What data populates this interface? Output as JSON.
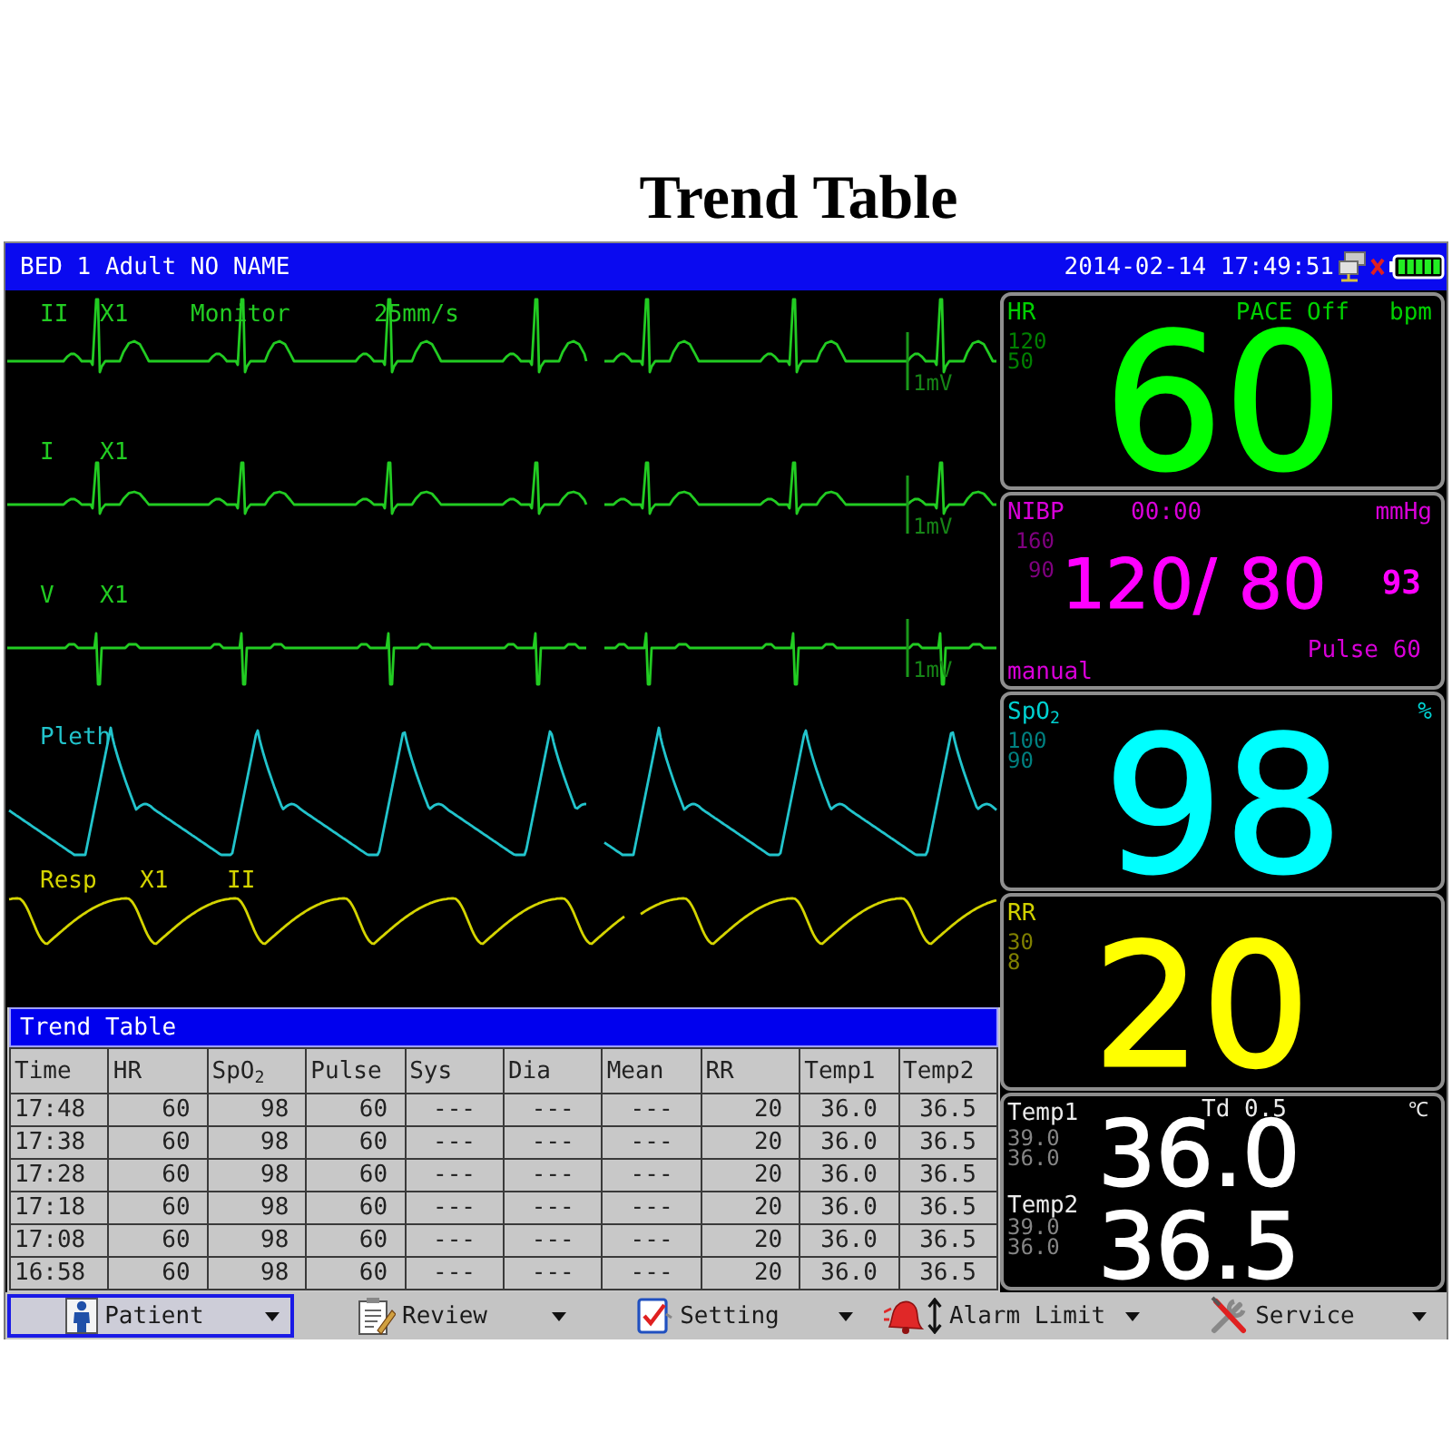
{
  "title": "Trend Table",
  "header": {
    "patient": "BED 1 Adult NO NAME",
    "datetime": "2014-02-14 17:49:51"
  },
  "waveforms": [
    {
      "kind": "ecg",
      "labels": [
        "II",
        "X1",
        "Monitor",
        "25mm/s"
      ],
      "scale": "1mV",
      "color": "#22cc22"
    },
    {
      "kind": "ecg",
      "labels": [
        "I",
        "X1"
      ],
      "scale": "1mV",
      "color": "#22cc22"
    },
    {
      "kind": "ecg",
      "labels": [
        "V",
        "X1"
      ],
      "scale": "1mV",
      "color": "#22cc22"
    },
    {
      "kind": "pleth",
      "labels": [
        "Pleth"
      ],
      "color": "#22c4cc"
    },
    {
      "kind": "resp",
      "labels": [
        "Resp",
        "X1",
        "II"
      ],
      "color": "#d4d400"
    }
  ],
  "parameters": [
    {
      "kind": "hr",
      "label": "HR",
      "limits": [
        "120",
        "50"
      ],
      "status": "PACE Off",
      "unit": "bpm",
      "value": "60",
      "color": "#00ff00"
    },
    {
      "kind": "nibp",
      "label": "NIBP",
      "time": "00:00",
      "unit": "mmHg",
      "limits": [
        "160",
        "90"
      ],
      "value": "120/ 80",
      "mean": "93",
      "pulse": "Pulse 60",
      "mode": "manual",
      "color": "#ff00ff"
    },
    {
      "kind": "spo2",
      "label": "SpO$_{2}$",
      "limits": [
        "100",
        "90"
      ],
      "unit": "%",
      "value": "98",
      "color": "#00ffff"
    },
    {
      "kind": "rr",
      "label": "RR",
      "limits": [
        "30",
        "8"
      ],
      "value": "20",
      "color": "#ffff00"
    },
    {
      "kind": "temp",
      "delta": "Td 0.5",
      "unit": "℃",
      "channels": [
        {
          "label": "Temp1",
          "limits": [
            "39.0",
            "36.0"
          ],
          "value": "36.0"
        },
        {
          "label": "Temp2",
          "limits": [
            "39.0",
            "36.0"
          ],
          "value": "36.5"
        }
      ],
      "color": "#ffffff"
    }
  ],
  "trend_table": {
    "title": "Trend Table",
    "columns": [
      "Time",
      "HR",
      "SpO$_{2}$",
      "Pulse",
      "Sys",
      "Dia",
      "Mean",
      "RR",
      "Temp1",
      "Temp2"
    ],
    "rows": [
      [
        "17:48",
        "60",
        "98",
        "60",
        "---",
        "---",
        "---",
        "20",
        "36.0",
        "36.5"
      ],
      [
        "17:38",
        "60",
        "98",
        "60",
        "---",
        "---",
        "---",
        "20",
        "36.0",
        "36.5"
      ],
      [
        "17:28",
        "60",
        "98",
        "60",
        "---",
        "---",
        "---",
        "20",
        "36.0",
        "36.5"
      ],
      [
        "17:18",
        "60",
        "98",
        "60",
        "---",
        "---",
        "---",
        "20",
        "36.0",
        "36.5"
      ],
      [
        "17:08",
        "60",
        "98",
        "60",
        "---",
        "---",
        "---",
        "20",
        "36.0",
        "36.5"
      ],
      [
        "16:58",
        "60",
        "98",
        "60",
        "---",
        "---",
        "---",
        "20",
        "36.0",
        "36.5"
      ]
    ]
  },
  "menu": [
    {
      "label": "Patient",
      "selected": true
    },
    {
      "label": "Review",
      "selected": false
    },
    {
      "label": "Setting",
      "selected": false
    },
    {
      "label": "Alarm Limit",
      "selected": false
    },
    {
      "label": "Service",
      "selected": false
    }
  ]
}
